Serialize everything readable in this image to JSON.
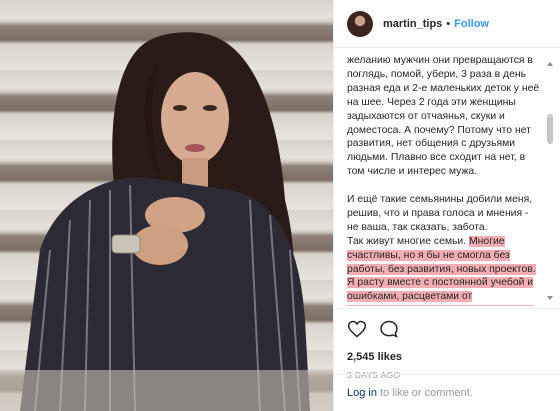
{
  "post": {
    "username": "martin_tips",
    "separator": "•",
    "follow_label": "Follow"
  },
  "caption": {
    "p1": "желанию мужчин они превращаются в поглядь, помой, убери, 3 раза в день разная еда и 2-е маленьких деток у неё на шее. Через 2 года эти женщины задыхаются от отчаянья, скуки и доместоса. А почему? Потому что нет развития, нет общения с друзьями людьми. Плавно все сходит на нет, в том числе и интерес мужа.",
    "p2": "И ещё такие семьянины добили меня, решив, что и права голоса и мнения - не ваша, так сказать, забота.",
    "p3_plain": "Так живут многие семьи.",
    "p3_highlight": "Многие счастливы, но я бы не смогла без работы, без развития, новых проектов. Я расту вместе с постоянной учебой и ошибками, расцветами от поставленных задач и успехов и своих детей буду учить никогда не забывать о себе."
  },
  "engagement": {
    "likes": "2,545 likes",
    "time": "3 DAYS AGO"
  },
  "comment_bar": {
    "login_link": "Log in",
    "rest": "to like or comment."
  },
  "icons": [
    "heart-icon",
    "comment-icon"
  ],
  "colors": {
    "follow": "#3897f0",
    "highlight": "#f4aeb3",
    "login_link": "#003569",
    "muted": "#999999"
  }
}
